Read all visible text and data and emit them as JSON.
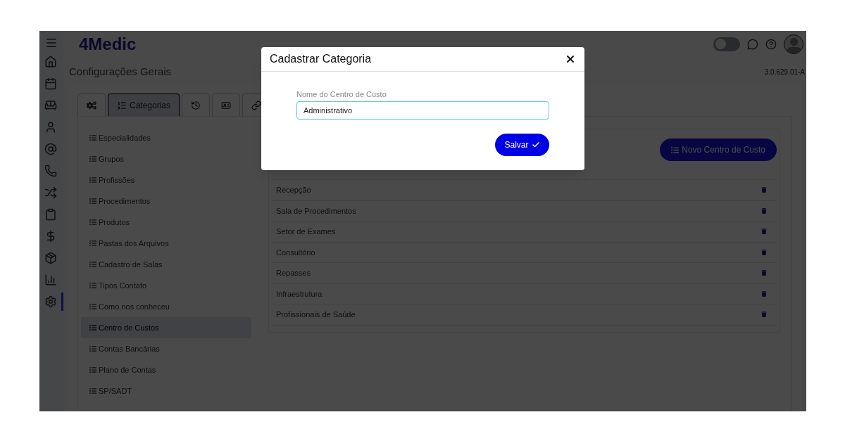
{
  "sidebar": {
    "items": [
      {
        "kind": "home",
        "selected": false
      },
      {
        "kind": "calendar",
        "selected": false
      },
      {
        "kind": "sofa",
        "selected": false
      },
      {
        "kind": "user",
        "selected": false
      },
      {
        "kind": "at",
        "selected": false
      },
      {
        "kind": "phone",
        "selected": false
      },
      {
        "kind": "shuffle",
        "selected": false
      },
      {
        "kind": "clipboard",
        "selected": false
      },
      {
        "kind": "dollar",
        "selected": false
      },
      {
        "kind": "box",
        "selected": false
      },
      {
        "kind": "chart",
        "selected": false
      },
      {
        "kind": "settings",
        "selected": true
      }
    ]
  },
  "header": {
    "logo": "4Medic",
    "toggle": {
      "on": false
    }
  },
  "page": {
    "title": "Configurações Gerais",
    "version": "3.0.629.01-A"
  },
  "tabs": [
    {
      "kind": "gears",
      "selected": false
    },
    {
      "kind": "list",
      "label": "Categorias",
      "selected": true
    },
    {
      "kind": "history",
      "selected": false
    },
    {
      "kind": "card",
      "selected": false
    },
    {
      "kind": "link",
      "selected": false
    }
  ],
  "categories": [
    {
      "label": "Especialidades",
      "selected": false
    },
    {
      "label": "Grupos",
      "selected": false
    },
    {
      "label": "Profissões",
      "selected": false
    },
    {
      "label": "Procedimentos",
      "selected": false
    },
    {
      "label": "Produtos",
      "selected": false
    },
    {
      "label": "Pastas dos Arquivos",
      "selected": false
    },
    {
      "label": "Cadastro de Salas",
      "selected": false
    },
    {
      "label": "Tipos Contato",
      "selected": false
    },
    {
      "label": "Como nos conheceu",
      "selected": false
    },
    {
      "label": "Centro de Custos",
      "selected": true
    },
    {
      "label": "Contas Bancárias",
      "selected": false
    },
    {
      "label": "Plano de Contas",
      "selected": false
    },
    {
      "label": "SP/SADT",
      "selected": false
    }
  ],
  "new_button": "Novo Centro de Custo",
  "rows": [
    "Recepção",
    "Sala de Procedimentos",
    "Setor de Exames",
    "Consultório",
    "Repasses",
    "Infraestrutura",
    "Profissionais de Saúde"
  ],
  "modal": {
    "title": "Cadastrar Categoria",
    "field_label": "Nome do Centro de Custo",
    "field_value": "Administrativo",
    "save_button": "Salvar"
  }
}
